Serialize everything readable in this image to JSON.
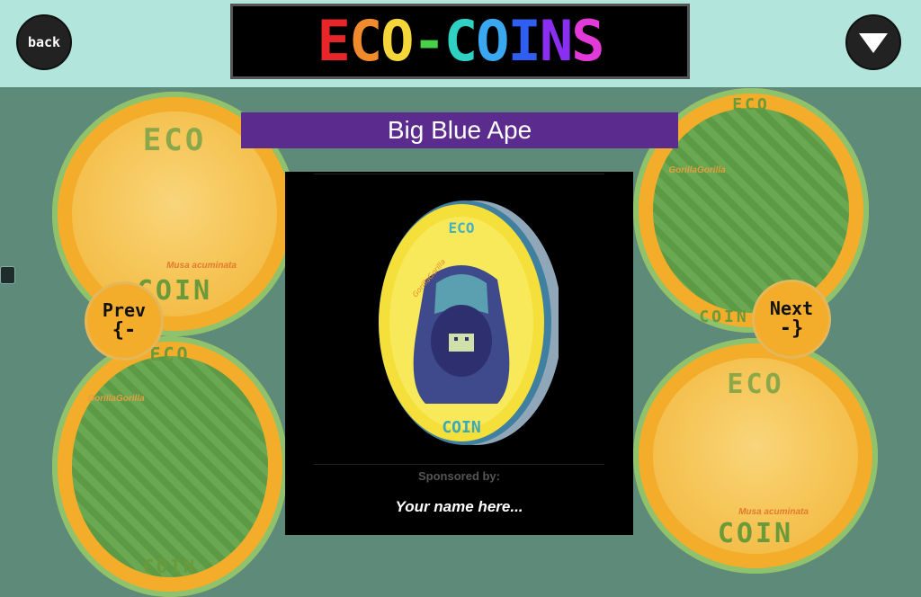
{
  "header": {
    "logo_letters": [
      {
        "ch": "E",
        "color": "#e8262a"
      },
      {
        "ch": "C",
        "color": "#f08a2c"
      },
      {
        "ch": "O",
        "color": "#f4d63a"
      },
      {
        "ch": "-",
        "color": "#4ad14a"
      },
      {
        "ch": "C",
        "color": "#2ed1c4"
      },
      {
        "ch": "O",
        "color": "#3aa8f0"
      },
      {
        "ch": "I",
        "color": "#2f5ef2"
      },
      {
        "ch": "N",
        "color": "#8a2ef2"
      },
      {
        "ch": "S",
        "color": "#e23ad8"
      }
    ],
    "back_label": "back"
  },
  "coins": {
    "top_left": {
      "word_top": "ECO",
      "word_bottom": "COIN",
      "tagline": "Musa acuminata"
    },
    "bottom_left": {
      "word_top": "ECO",
      "word_bottom": "COIN",
      "tagline": "GorillaGorilla"
    },
    "top_right": {
      "word_top": "ECO",
      "word_bottom": "COIN",
      "tagline": "GorillaGorilla"
    },
    "bottom_right": {
      "word_top": "ECO",
      "word_bottom": "COIN",
      "tagline": "Musa acuminata"
    }
  },
  "nav": {
    "prev_line1": "Prev",
    "prev_line2": "{-",
    "next_line1": "Next",
    "next_line2": "-}"
  },
  "selected": {
    "title": "Big Blue Ape",
    "coin_word_top": "ECO",
    "coin_word_bottom": "COIN",
    "coin_tagline": "GorillaGorilla",
    "sponsor_label": "Sponsored by:",
    "sponsor_name": "Your name here..."
  },
  "colors": {
    "topbar": "#b2e6dc",
    "background": "#5e8a7a",
    "banner": "#5b2c8e",
    "coin_gold": "#f3ad2a",
    "coin_rim": "#8fc26c"
  }
}
